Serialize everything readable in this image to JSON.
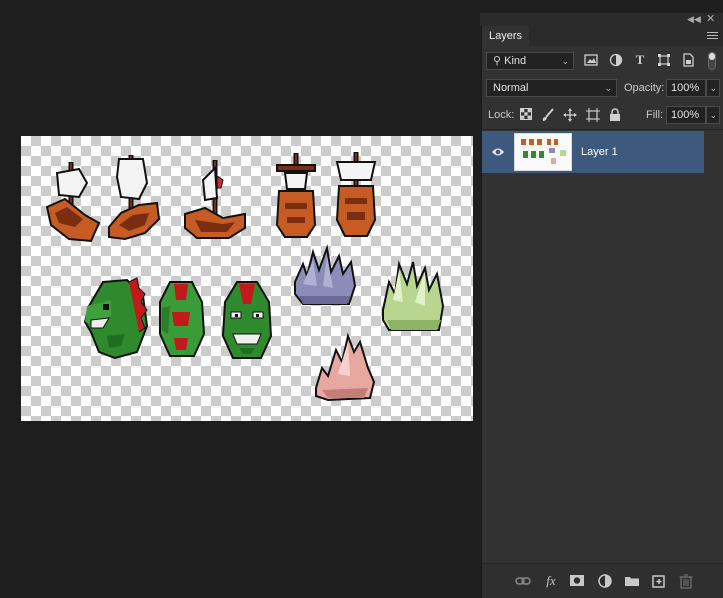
{
  "panel": {
    "title": "Layers",
    "filter": {
      "kind_label": "Kind"
    },
    "blend_mode": "Normal",
    "opacity_label": "Opacity:",
    "opacity_value": "100%",
    "lock_label": "Lock:",
    "fill_label": "Fill:",
    "fill_value": "100%"
  },
  "layers": [
    {
      "name": "Layer 1",
      "visible": true,
      "selected": true
    }
  ],
  "icons": {
    "filter": [
      "image-filter-icon",
      "adjustment-filter-icon",
      "type-filter-icon",
      "shape-filter-icon",
      "smart-object-filter-icon"
    ],
    "lock": [
      "lock-transparent-pixels-icon",
      "lock-image-pixels-icon",
      "lock-position-icon",
      "lock-artboard-icon",
      "lock-all-icon"
    ],
    "footer": [
      "link-layers-icon",
      "fx-icon",
      "add-mask-icon",
      "new-adjustment-icon",
      "new-group-icon",
      "new-layer-icon",
      "delete-layer-icon"
    ]
  },
  "colors": {
    "selected_row": "#3d5a7e",
    "panel_bg": "#323232",
    "workspace_bg": "#1e1e1e"
  }
}
